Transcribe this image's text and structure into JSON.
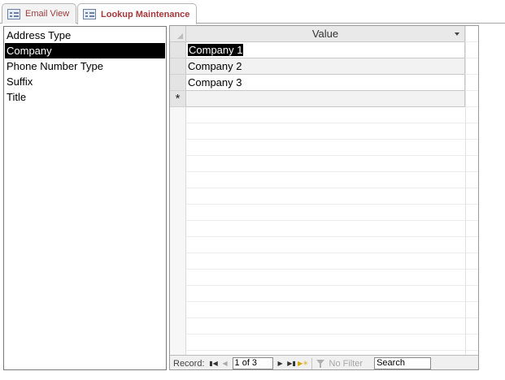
{
  "tabs": [
    {
      "label": "Email View",
      "active": false
    },
    {
      "label": "Lookup Maintenance",
      "active": true
    }
  ],
  "lookup_list": {
    "items": [
      "Address Type",
      "Company",
      "Phone Number Type",
      "Suffix",
      "Title"
    ],
    "selected": "Company"
  },
  "datasheet": {
    "column_header": "Value",
    "rows": [
      "Company 1",
      "Company 2",
      "Company 3"
    ],
    "new_row_marker": "*"
  },
  "navigation": {
    "record_label": "Record:",
    "first_icon": "first-record-icon",
    "prev_icon": "prev-record-icon",
    "current_record": "1 of 3",
    "next_icon": "next-record-icon",
    "last_icon": "last-record-icon",
    "new_icon": "new-record-icon",
    "filter_label": "No Filter",
    "search_label": "Search"
  },
  "colors": {
    "active_tab_text": "#a4373a",
    "selection": "#000000",
    "header_bg": "#e9e9e9"
  }
}
